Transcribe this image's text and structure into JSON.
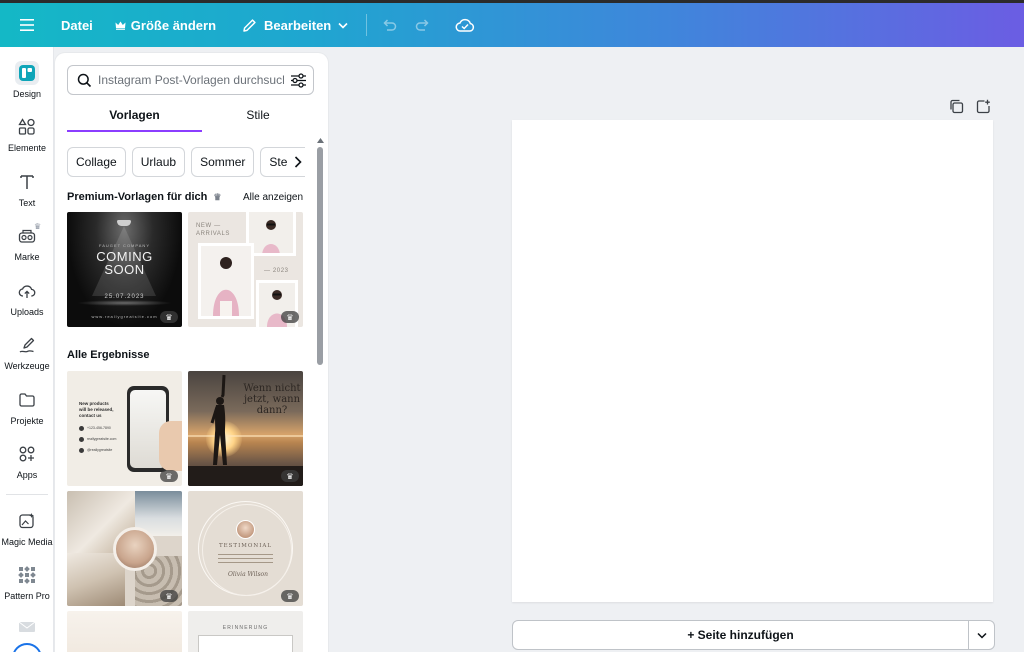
{
  "topbar": {
    "file_label": "Datei",
    "resize_label": "Größe ändern",
    "edit_label": "Bearbeiten",
    "icons": [
      "menu-icon",
      "crown-icon",
      "pencil-icon",
      "chevron-down-icon",
      "undo-icon",
      "redo-icon",
      "cloud-check-icon"
    ]
  },
  "rail": {
    "items": [
      {
        "label": "Design",
        "icon": "design-icon"
      },
      {
        "label": "Elemente",
        "icon": "elements-icon"
      },
      {
        "label": "Text",
        "icon": "text-icon"
      },
      {
        "label": "Marke",
        "icon": "brand-icon"
      },
      {
        "label": "Uploads",
        "icon": "upload-cloud-icon"
      },
      {
        "label": "Werkzeuge",
        "icon": "draw-tools-icon"
      },
      {
        "label": "Projekte",
        "icon": "folder-icon"
      },
      {
        "label": "Apps",
        "icon": "apps-icon"
      },
      {
        "label": "Magic Media",
        "icon": "magic-media-icon"
      },
      {
        "label": "Pattern Pro",
        "icon": "pattern-icon"
      }
    ]
  },
  "panel": {
    "search": {
      "placeholder": "Instagram Post-Vorlagen durchsuchen",
      "value": ""
    },
    "tabs": [
      {
        "label": "Vorlagen",
        "active": true
      },
      {
        "label": "Stile",
        "active": false
      }
    ],
    "chips": [
      "Collage",
      "Urlaub",
      "Sommer",
      "Stellen"
    ],
    "premium": {
      "title": "Premium-Vorlagen für dich",
      "see_all": "Alle anzeigen"
    },
    "all_results_title": "Alle Ergebnisse",
    "templates": {
      "coming_soon": {
        "brand": "FAUGET COMPANY",
        "title_line1": "COMING",
        "title_line2": "SOON",
        "date": "25.07.2023",
        "site": "www.reallygreatsite.com"
      },
      "new_arrivals": {
        "text_line1": "NEW —",
        "text_line2": "ARRIVALS",
        "year": "— 2023"
      },
      "new_products": {
        "line1": "New products",
        "line2": "will be released,",
        "line3": "contact us",
        "phone": "+123-456-7890",
        "site": "reallygreatsite.com",
        "handle": "@reallygreatsite"
      },
      "sunset": {
        "line1": "Wenn nicht",
        "line2": "jetzt, wann",
        "line3": "dann?"
      },
      "testimonial": {
        "title": "TESTIMONIAL",
        "signature": "Olivia Wilson"
      },
      "reminder": {
        "title": "ERINNERUNG"
      }
    }
  },
  "canvas": {
    "add_page_label": "+ Seite hinzufügen",
    "icons": [
      "duplicate-page-icon",
      "add-page-icon",
      "chevron-down-icon"
    ]
  },
  "colors": {
    "gradient_start": "#14b8c6",
    "gradient_end": "#6b5de3",
    "accent_purple": "#8b3dff",
    "canvas_bg": "#eef0f3"
  }
}
